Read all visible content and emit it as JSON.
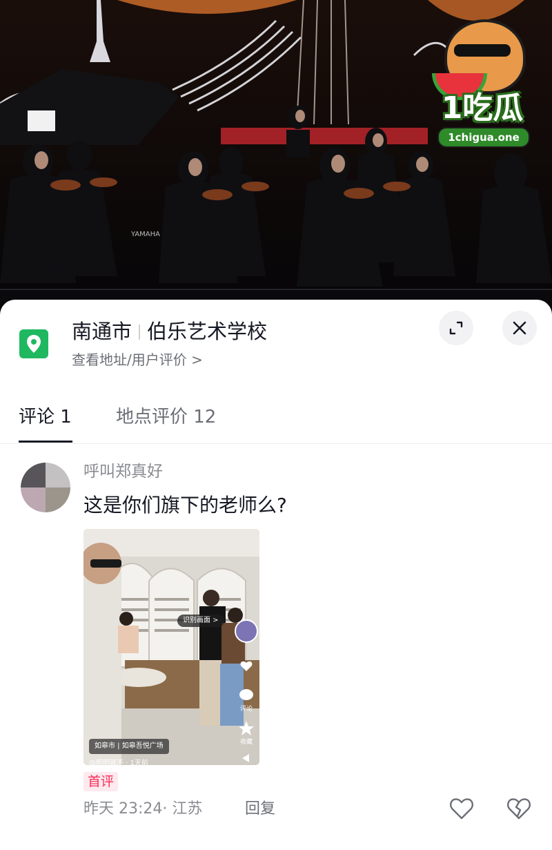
{
  "watermark": {
    "brand": "1吃瓜",
    "url": "1chigua.one"
  },
  "place": {
    "city": "南通市",
    "name": "伯乐艺术学校",
    "subtitle": "查看地址/用户评价 >",
    "icon": "map-pin-icon",
    "color": "#1fb860"
  },
  "header_actions": {
    "expand_icon": "expand-icon",
    "close_icon": "close-icon"
  },
  "tabs": [
    {
      "label": "评论 1",
      "active": true
    },
    {
      "label": "地点评价 12",
      "active": false
    }
  ],
  "comment": {
    "username": "呼叫郑真好",
    "text": "这是你们旗下的老师么?",
    "badge": "首评",
    "timestamp": "昨天 23:24· 江苏",
    "reply_label": "回复",
    "attachment": {
      "tag": "识别画面 >",
      "location": "如皋市 | 如皋吾悦广场",
      "author": "@明明就不 · 1天前",
      "side_labels": [
        "评论",
        "收藏"
      ]
    }
  },
  "colors": {
    "accent": "#fe2c55",
    "text_primary": "#161823",
    "text_secondary": "#8a8b91"
  }
}
